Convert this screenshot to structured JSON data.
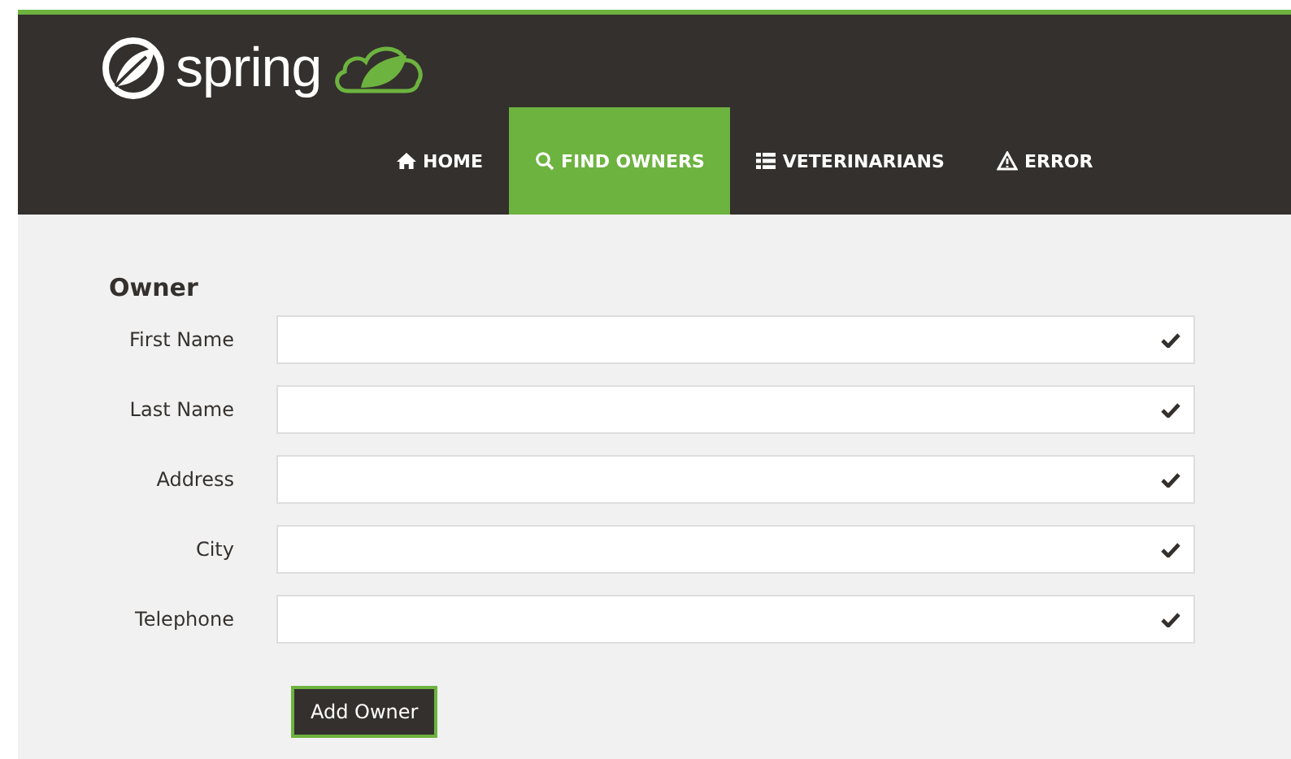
{
  "logo": {
    "text": "spring"
  },
  "nav": [
    {
      "kind": "home",
      "label": "HOME",
      "selected": false
    },
    {
      "kind": "search",
      "label": "FIND OWNERS",
      "selected": true
    },
    {
      "kind": "list",
      "label": "VETERINARIANS",
      "selected": false
    },
    {
      "kind": "warning",
      "label": "ERROR",
      "selected": false
    }
  ],
  "form": {
    "title": "Owner",
    "fields": [
      {
        "label": "First Name",
        "valid": true
      },
      {
        "label": "Last Name",
        "valid": true
      },
      {
        "label": "Address",
        "valid": true
      },
      {
        "label": "City",
        "valid": true
      },
      {
        "label": "Telephone",
        "valid": true
      }
    ],
    "submit": "Add Owner"
  }
}
